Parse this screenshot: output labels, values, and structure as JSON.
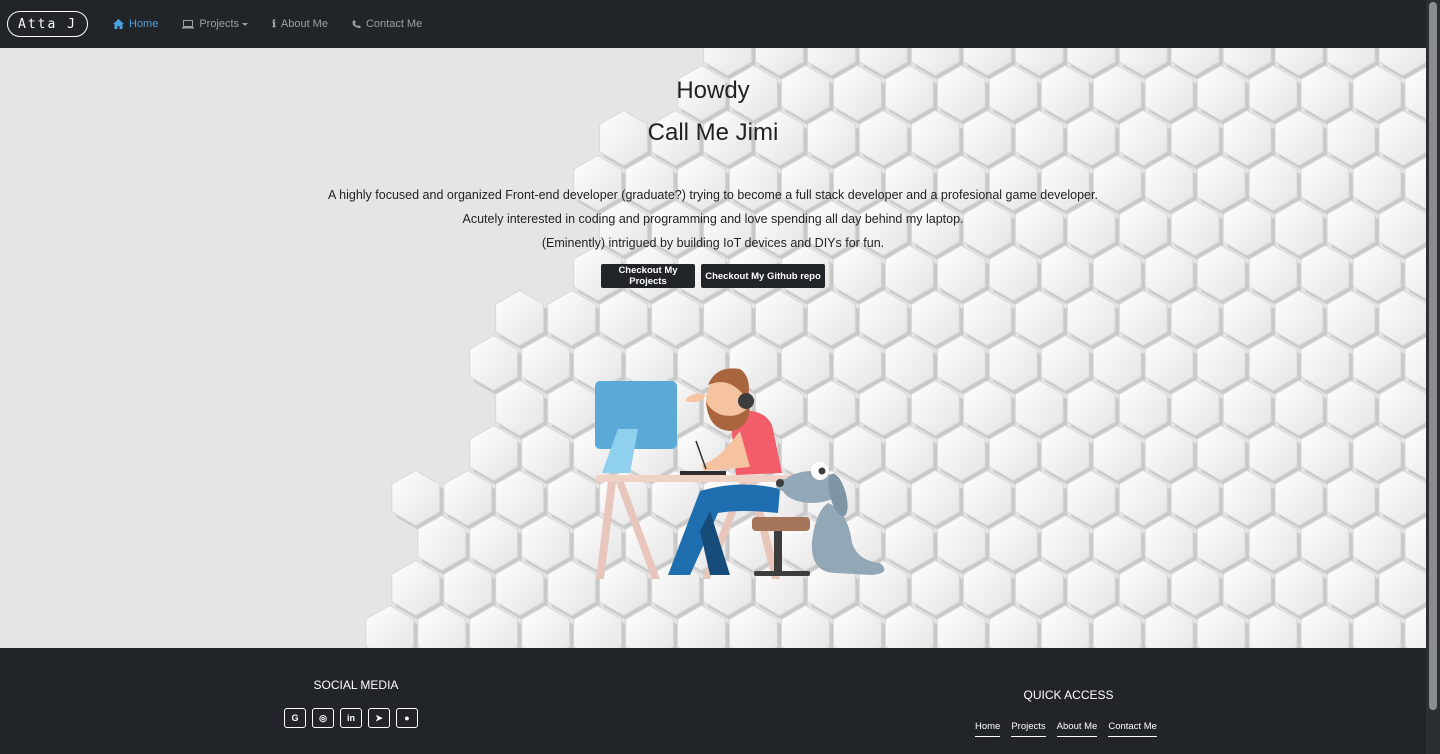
{
  "navbar": {
    "brand": "Atta J",
    "items": [
      {
        "label": "Home",
        "icon": "home-icon"
      },
      {
        "label": "Projects",
        "icon": "laptop-icon"
      },
      {
        "label": "About Me",
        "icon": "info-icon"
      },
      {
        "label": "Contact Me",
        "icon": "phone-icon"
      }
    ],
    "active_color": "#4aa3df"
  },
  "hero": {
    "greeting": "Howdy",
    "name": "Call Me Jimi",
    "lines": [
      "A highly focused and organized Front-end developer (graduate?) trying to become a full stack developer and a profesional game developer.",
      "Acutely interested in coding and programming and love spending all day behind my laptop.",
      "(Eminently) intrigued by building IoT devices and DIYs for fun."
    ],
    "buttons": {
      "projects": "Checkout My Projects",
      "github": "Checkout My Github repo"
    }
  },
  "footer": {
    "social_title": "SOCIAL MEDIA",
    "social_icons": [
      {
        "name": "google-icon",
        "glyph": "G"
      },
      {
        "name": "instagram-icon",
        "glyph": "◎"
      },
      {
        "name": "linkedin-icon",
        "glyph": "in"
      },
      {
        "name": "telegram-icon",
        "glyph": "➤"
      },
      {
        "name": "github-icon",
        "glyph": "●"
      }
    ],
    "quick_title": "QUICK ACCESS",
    "quick_links": [
      "Home",
      "Projects",
      "About Me",
      "Contact Me"
    ]
  }
}
